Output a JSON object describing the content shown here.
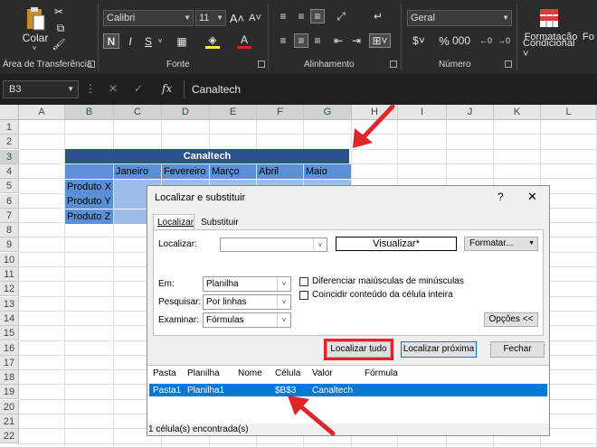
{
  "ribbon": {
    "clipboard": {
      "paste_label": "Colar",
      "group_label": "Área de Transferência"
    },
    "font": {
      "font_name": "Calibri",
      "font_size": "11",
      "bold": "N",
      "italic": "I",
      "underline": "S",
      "group_label": "Fonte"
    },
    "alignment": {
      "group_label": "Alinhamento"
    },
    "number": {
      "format": "Geral",
      "group_label": "Número"
    },
    "styles": {
      "conditional_format_line1": "Formatação",
      "conditional_format_line2": "Condicional ˅",
      "next_label": "Fo"
    }
  },
  "formula_bar": {
    "name_box": "B3",
    "fx": "fx",
    "value": "Canaltech"
  },
  "sheet": {
    "columns": [
      "A",
      "B",
      "C",
      "D",
      "E",
      "F",
      "G",
      "H",
      "I",
      "J",
      "K",
      "L"
    ],
    "rows": [
      "1",
      "2",
      "3",
      "4",
      "5",
      "6",
      "7",
      "8",
      "9",
      "10",
      "11",
      "12",
      "13",
      "14",
      "15",
      "16",
      "17",
      "18",
      "19",
      "20",
      "21",
      "22"
    ],
    "title": "Canaltech",
    "months": [
      "Janeiro",
      "Fevereiro",
      "Março",
      "Abril",
      "Maio"
    ],
    "products": [
      "Produto X",
      "Produto Y",
      "Produto Z"
    ]
  },
  "dialog": {
    "title": "Localizar e substituir",
    "help": "?",
    "close": "✕",
    "tabs": [
      "Localizar",
      "Substituir"
    ],
    "find_label": "Localizar:",
    "find_value": "",
    "preview": "Visualizar*",
    "format_button": "Formatar...",
    "within_label": "Em:",
    "within_value": "Planilha",
    "search_label": "Pesquisar:",
    "search_value": "Por linhas",
    "look_in_label": "Examinar:",
    "look_in_value": "Fórmulas",
    "match_case": "Diferenciar maiúsculas de minúsculas",
    "match_entire": "Coincidir conteúdo da célula inteira",
    "options_button": "Opções <<",
    "find_all": "Localizar tudo",
    "find_next": "Localizar próxima",
    "close_button": "Fechar",
    "results_headers": [
      "Pasta",
      "Planilha",
      "Nome",
      "Célula",
      "Valor",
      "Fórmula"
    ],
    "results_row": [
      "Pasta1",
      "Planilha1",
      "",
      "$B$3",
      "Canaltech",
      ""
    ],
    "status": "1 célula(s) encontrada(s)"
  },
  "colors": {
    "header_blue": "#2e4f8f",
    "cell_blue": "#5b8fd6",
    "selection_blue": "#0078d7",
    "arrow_red": "#e0252a"
  }
}
